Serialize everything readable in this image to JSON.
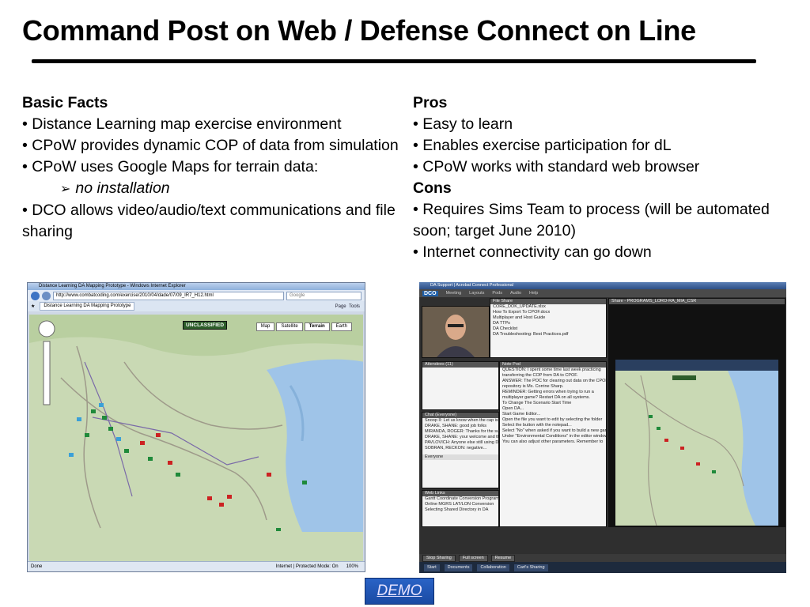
{
  "title": "Command Post on Web / Defense Connect on Line",
  "left_column": {
    "heading": "Basic Facts",
    "bullets": [
      "• Distance Learning map exercise environment",
      "• CPoW provides dynamic COP of data from simulation",
      "• CPoW uses Google Maps for terrain data:"
    ],
    "sub_bullet_arrow": "➢",
    "sub_bullet": "no installation",
    "bullets_after": [
      "• DCO allows video/audio/text communications and file sharing"
    ]
  },
  "right_column": {
    "pros_heading": "Pros",
    "pros": [
      "• Easy to learn",
      "• Enables exercise participation for dL",
      "• CPoW works with standard web browser"
    ],
    "cons_heading": "Cons",
    "cons": [
      "• Requires Sims Team to process (will be automated soon; target June 2010)",
      "• Internet connectivity can go down"
    ]
  },
  "browser_screenshot": {
    "window_title": "Distance Learning DA Mapping Prototype - Windows Internet Explorer",
    "url": "http://www.combatcoding.com/exercise/2010/04/dade/07/09_IR7_H12.html",
    "search_placeholder": "Google",
    "tab_label": "Distance Learning DA Mapping Prototype",
    "toolbar_page": "Page",
    "toolbar_tools": "Tools",
    "banner": "UNCLASSIFIED",
    "map_types": [
      "Map",
      "Satellite",
      "Terrain",
      "Earth"
    ],
    "status_left": "Done",
    "status_zone": "Internet | Protected Mode: On",
    "status_zoom": "100%"
  },
  "connect_screenshot": {
    "window_title": "DA Support | Acrobat Connect Professional",
    "logo": "DCO",
    "menu": [
      "Meeting",
      "Layouts",
      "Pods",
      "Audio",
      "Help"
    ],
    "attendees_header": "Attendees (11)",
    "file_header": "File Share",
    "files": [
      "CORE_DOK_UPDATE.xlsx",
      "How To Export To CPOF.docx",
      "Multiplayer and Host Guide",
      "DA TTPs",
      "DA Checklist",
      "DA Troubleshooting: Best Practices.pdf"
    ],
    "share_header": "Share - PROGRAMS_LORO-RA_MIA_CSR",
    "notes_header": "Note Pod",
    "notes_lines": [
      "QUESTION: I spent some time last week practicing",
      "transferring the COP from DA to CPOF.",
      "ANSWER: The POC for clearing out data on the CPOF",
      "repository is Ms. Corrine Sharp.",
      "REMINDER: Getting errors when trying to run a",
      "multiplayer game? Restart DA on all systems.",
      "To Change The Scenario Start Time",
      "Open DA...",
      "Start Game Editor...",
      "Open the file you want to edit by selecting the folder",
      "Select the button with the notepad...",
      "Select \"No\" when asked if you want to build a new game",
      "Under \"Environmental Conditions\" in the editor window,",
      "You can also adjust other parameters. Remember to"
    ],
    "chat_header": "Chat (Everyone)",
    "chat_lines": [
      "Snoop II: Let us know when the cap is over",
      "DRAKE, SHANE: good job folks",
      "MIRANDA, ROGER: Thanks for the support",
      "DRAKE, SHANE: your welcome and thank you",
      "PAVLOVICH: Anyone else still using DA?",
      "SOBRAN, RECKON: negative...",
      "Everyone"
    ],
    "links_header": "Web Links",
    "links": [
      "Gantt Coordinate Conversion Program",
      "Online MGRS LAT/LON Conversion",
      "Selecting Shared Directory in DA"
    ],
    "footer_buttons": [
      "Stop Sharing",
      "Full screen",
      "Resume"
    ],
    "taskbar": [
      "Start",
      "Documents",
      "Collaboration",
      "Cart's Sharing"
    ]
  },
  "demo_button": "DEMO",
  "colors": {
    "rule": "#000000",
    "demo_bg": "#2a63c6",
    "demo_text": "#e8e3ff",
    "map_land": "#c9d9b4",
    "map_water": "#9fc4e8"
  }
}
